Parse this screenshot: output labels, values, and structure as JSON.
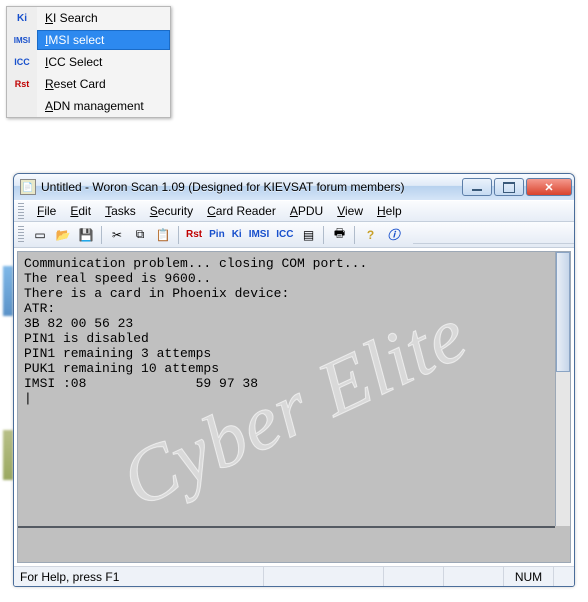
{
  "popup": {
    "items": [
      {
        "icon": "Ki",
        "label_prefix": "K",
        "label_rest": "I Search"
      },
      {
        "icon": "IMSI",
        "label_prefix": "I",
        "label_rest": "MSI select",
        "selected": true
      },
      {
        "icon": "ICC",
        "label_prefix": "I",
        "label_rest": "CC Select"
      },
      {
        "icon": "Rst",
        "label_prefix": "R",
        "label_rest": "eset Card"
      },
      {
        "icon": "",
        "label_prefix": "A",
        "label_rest": "DN management"
      }
    ]
  },
  "window": {
    "title": "Untitled - Woron Scan 1.09 (Designed for KIEVSAT forum members)",
    "menus": [
      {
        "u": "F",
        "rest": "ile"
      },
      {
        "u": "E",
        "rest": "dit"
      },
      {
        "u": "T",
        "rest": "asks"
      },
      {
        "u": "S",
        "rest": "ecurity"
      },
      {
        "u": "C",
        "rest": "ard Reader"
      },
      {
        "u": "A",
        "rest": "PDU"
      },
      {
        "u": "V",
        "rest": "iew"
      },
      {
        "u": "H",
        "rest": "elp"
      }
    ],
    "toolbar": {
      "rst": "Rst",
      "pin": "Pin",
      "ki": "Ki",
      "imsi": "IMSI",
      "icc": "ICC"
    },
    "output": "Communication problem... closing COM port...\nThe real speed is 9600..\nThere is a card in Phoenix device:\nATR:\n3B 82 00 56 23\nPIN1 is disabled\nPIN1 remaining 3 attemps\nPUK1 remaining 10 attemps\nIMSI :08              59 97 38\n|",
    "watermark": "Cyber Elite",
    "status": {
      "help": "For Help, press F1",
      "num": "NUM"
    }
  }
}
